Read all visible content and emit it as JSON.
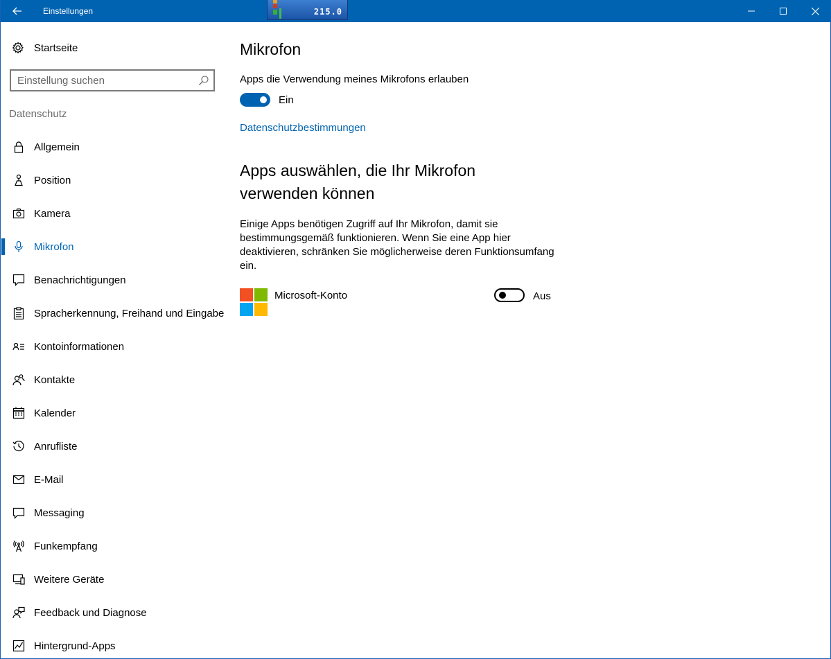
{
  "window": {
    "title": "Einstellungen",
    "widget_value": "215.0"
  },
  "sidebar": {
    "home_label": "Startseite",
    "search_placeholder": "Einstellung suchen",
    "section_title": "Datenschutz",
    "items": [
      {
        "label": "Allgemein",
        "icon": "lock-icon"
      },
      {
        "label": "Position",
        "icon": "location-icon"
      },
      {
        "label": "Kamera",
        "icon": "camera-icon"
      },
      {
        "label": "Mikrofon",
        "icon": "microphone-icon",
        "active": true
      },
      {
        "label": "Benachrichtigungen",
        "icon": "notification-icon"
      },
      {
        "label": "Spracherkennung, Freihand und Eingabe",
        "icon": "clipboard-icon"
      },
      {
        "label": "Kontoinformationen",
        "icon": "account-info-icon"
      },
      {
        "label": "Kontakte",
        "icon": "contacts-icon"
      },
      {
        "label": "Kalender",
        "icon": "calendar-icon"
      },
      {
        "label": "Anrufliste",
        "icon": "history-icon"
      },
      {
        "label": "E-Mail",
        "icon": "mail-icon"
      },
      {
        "label": "Messaging",
        "icon": "message-icon"
      },
      {
        "label": "Funkempfang",
        "icon": "radio-icon"
      },
      {
        "label": "Weitere Geräte",
        "icon": "devices-icon"
      },
      {
        "label": "Feedback und Diagnose",
        "icon": "feedback-icon"
      },
      {
        "label": "Hintergrund-Apps",
        "icon": "background-apps-icon"
      }
    ]
  },
  "main": {
    "title": "Mikrofon",
    "allow_label": "Apps die Verwendung meines Mikrofons erlauben",
    "allow_toggle_state": "Ein",
    "privacy_link": "Datenschutzbestimmungen",
    "section_heading": "Apps auswählen, die Ihr Mikrofon verwenden können",
    "section_description": "Einige Apps benötigen Zugriff auf Ihr Mikrofon, damit sie bestimmungsgemäß funktionieren. Wenn Sie eine App hier deaktivieren, schränken Sie möglicherweise deren Funktionsumfang ein.",
    "apps": [
      {
        "name": "Microsoft-Konto",
        "state": "Aus"
      }
    ]
  },
  "colors": {
    "accent": "#0063b1",
    "titlebar": "#0063b1",
    "ms_red": "#f25022",
    "ms_green": "#7fba00",
    "ms_blue": "#00a4ef",
    "ms_yellow": "#ffb900"
  }
}
